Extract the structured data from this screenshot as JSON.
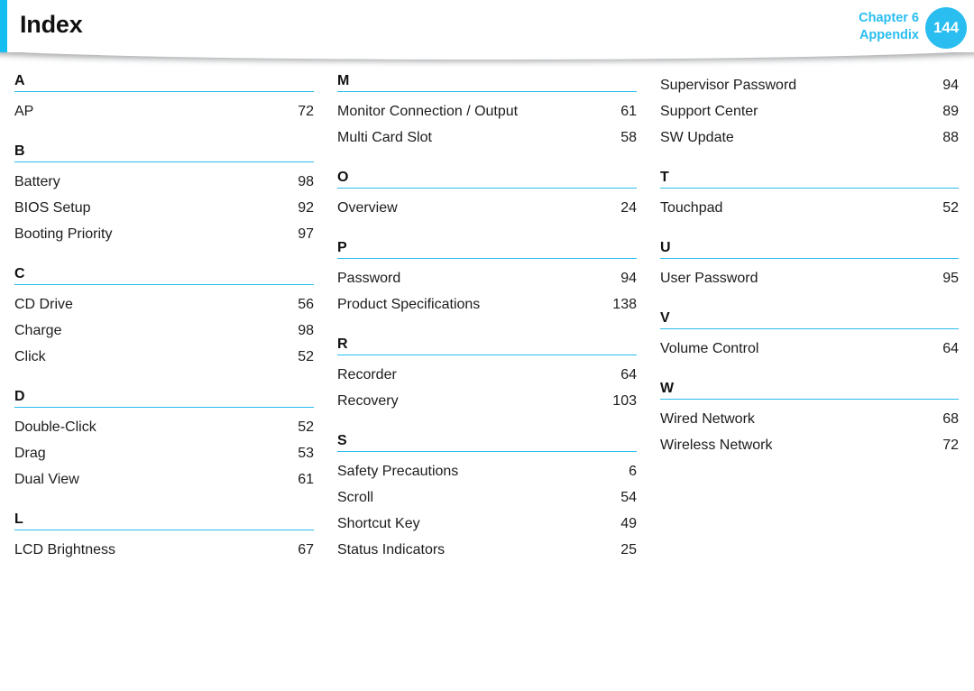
{
  "header": {
    "title": "Index",
    "chapter_label": "Chapter 6",
    "section_label": "Appendix",
    "page_number": "144",
    "accent_color": "#14BEF0",
    "badge_color": "#29BDF0",
    "chapter_text_color": "#29BDF0"
  },
  "index": {
    "rule_color": "#29BDF0",
    "columns": [
      {
        "sections": [
          {
            "letter": "A",
            "entries": [
              {
                "title": "AP",
                "page": "72"
              }
            ]
          },
          {
            "letter": "B",
            "entries": [
              {
                "title": "Battery",
                "page": "98"
              },
              {
                "title": "BIOS Setup",
                "page": "92"
              },
              {
                "title": "Booting Priority",
                "page": "97"
              }
            ]
          },
          {
            "letter": "C",
            "entries": [
              {
                "title": "CD Drive",
                "page": "56"
              },
              {
                "title": "Charge",
                "page": "98"
              },
              {
                "title": "Click",
                "page": "52"
              }
            ]
          },
          {
            "letter": "D",
            "entries": [
              {
                "title": "Double-Click",
                "page": "52"
              },
              {
                "title": "Drag",
                "page": "53"
              },
              {
                "title": "Dual View",
                "page": "61"
              }
            ]
          },
          {
            "letter": "L",
            "entries": [
              {
                "title": "LCD Brightness",
                "page": "67"
              }
            ]
          }
        ]
      },
      {
        "sections": [
          {
            "letter": "M",
            "entries": [
              {
                "title": "Monitor Connection / Output",
                "page": "61"
              },
              {
                "title": "Multi Card Slot",
                "page": "58"
              }
            ]
          },
          {
            "letter": "O",
            "entries": [
              {
                "title": "Overview",
                "page": "24"
              }
            ]
          },
          {
            "letter": "P",
            "entries": [
              {
                "title": "Password",
                "page": "94"
              },
              {
                "title": "Product Specifications",
                "page": "138"
              }
            ]
          },
          {
            "letter": "R",
            "entries": [
              {
                "title": "Recorder",
                "page": "64"
              },
              {
                "title": "Recovery",
                "page": "103"
              }
            ]
          },
          {
            "letter": "S",
            "entries": [
              {
                "title": "Safety Precautions",
                "page": "6"
              },
              {
                "title": "Scroll",
                "page": "54"
              },
              {
                "title": "Shortcut Key",
                "page": "49"
              },
              {
                "title": "Status Indicators",
                "page": "25"
              }
            ]
          }
        ]
      },
      {
        "sections": [
          {
            "letter": "",
            "entries": [
              {
                "title": "Supervisor Password",
                "page": "94"
              },
              {
                "title": "Support Center",
                "page": "89"
              },
              {
                "title": "SW Update",
                "page": "88"
              }
            ]
          },
          {
            "letter": "T",
            "entries": [
              {
                "title": "Touchpad",
                "page": "52"
              }
            ]
          },
          {
            "letter": "U",
            "entries": [
              {
                "title": "User Password",
                "page": "95"
              }
            ]
          },
          {
            "letter": "V",
            "entries": [
              {
                "title": "Volume Control",
                "page": "64"
              }
            ]
          },
          {
            "letter": "W",
            "entries": [
              {
                "title": "Wired Network",
                "page": "68"
              },
              {
                "title": "Wireless Network",
                "page": "72"
              }
            ]
          }
        ]
      }
    ]
  }
}
